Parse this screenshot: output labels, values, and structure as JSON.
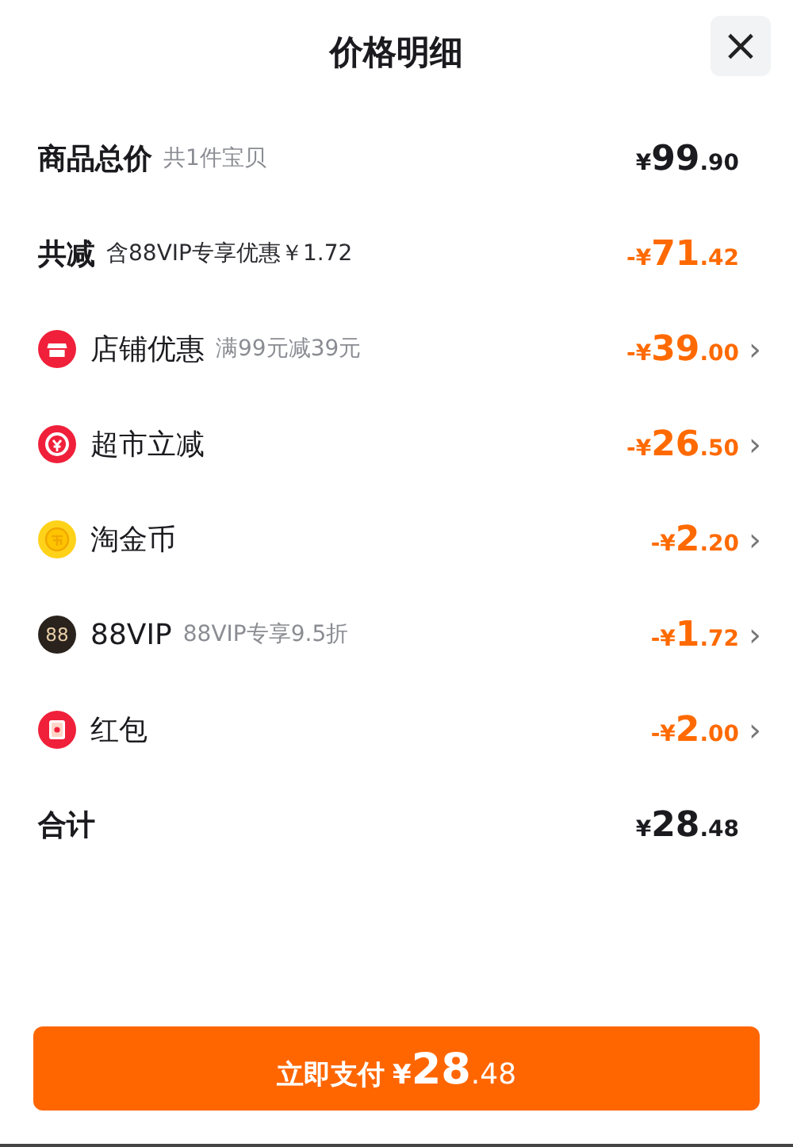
{
  "header": {
    "title": "价格明细",
    "close": "×"
  },
  "rows": [
    {
      "kind": "subtotal",
      "label": "商品总价",
      "note": "共1件宝贝",
      "amount": {
        "currency": "¥",
        "whole": "99",
        "fraction": ".90"
      }
    },
    {
      "kind": "reduction",
      "label": "共减",
      "note": "含88VIP专享优惠￥1.72",
      "amount": {
        "sign": "-",
        "currency": "¥",
        "whole": "71",
        "fraction": ".42"
      }
    },
    {
      "kind": "shop",
      "label": "店铺优惠",
      "note": "满99元减39元",
      "amount": {
        "sign": "-",
        "currency": "¥",
        "whole": "39",
        "fraction": ".00"
      },
      "chevron": "›"
    },
    {
      "kind": "market",
      "label": "超市立减",
      "amount": {
        "sign": "-",
        "currency": "¥",
        "whole": "26",
        "fraction": ".50"
      },
      "chevron": "›"
    },
    {
      "kind": "coin",
      "label": "淘金币",
      "amount": {
        "sign": "-",
        "currency": "¥",
        "whole": "2",
        "fraction": ".20"
      },
      "chevron": "›"
    },
    {
      "kind": "vip",
      "icon_text": "88",
      "label": "88VIP",
      "note": "88VIP专享9.5折",
      "amount": {
        "sign": "-",
        "currency": "¥",
        "whole": "1",
        "fraction": ".72"
      },
      "chevron": "›"
    },
    {
      "kind": "packet",
      "label": "红包",
      "amount": {
        "sign": "-",
        "currency": "¥",
        "whole": "2",
        "fraction": ".00"
      },
      "chevron": "›"
    },
    {
      "kind": "subtotal",
      "label": "合计",
      "amount": {
        "currency": "¥",
        "whole": "28",
        "fraction": ".48"
      }
    }
  ],
  "pay_button": {
    "label": "立即支付",
    "amount": {
      "currency": "¥",
      "whole": "28",
      "fraction": ".48"
    }
  }
}
